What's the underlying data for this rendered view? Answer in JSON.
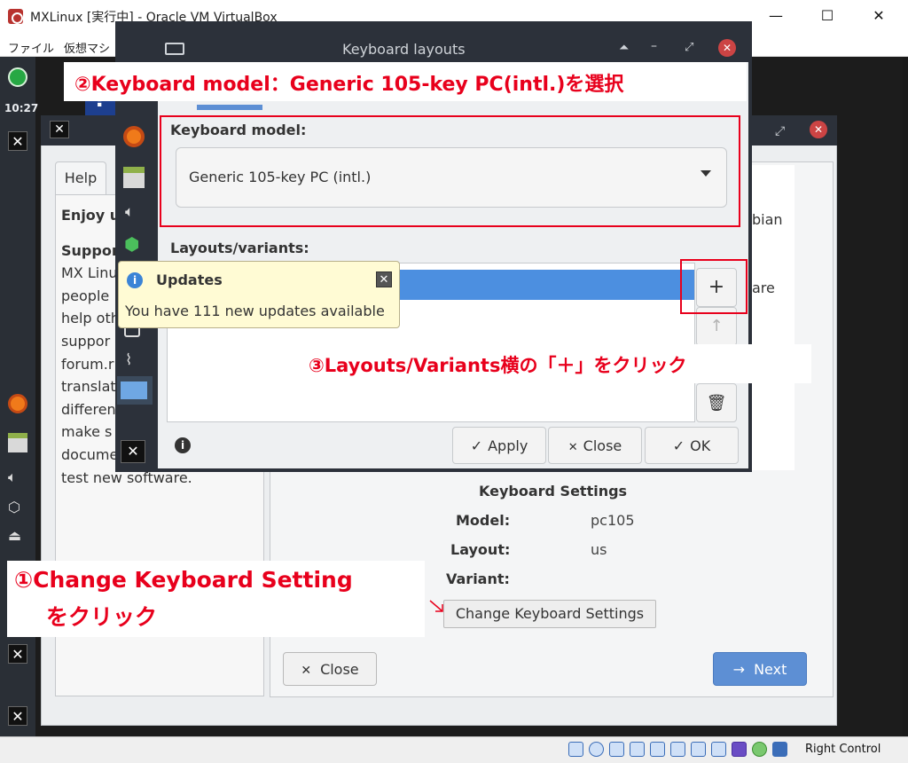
{
  "vbox": {
    "title": "MXLinux [実行中] - Oracle VM VirtualBox",
    "menus": [
      "ファイル",
      "仮想マシ"
    ],
    "status_text": "Right Control"
  },
  "panel": {
    "clock": "10:27"
  },
  "welcome": {
    "help_tab": "Help",
    "help_lines": [
      "Enjoy u",
      "Suppor",
      "MX Linu",
      "people",
      "help oth",
      "suppor",
      "forum.r",
      "translat",
      "differen",
      "make s",
      "docume",
      "test new software."
    ],
    "right_fragments": {
      "line1": "bian",
      "line2": "are"
    },
    "keyboard_settings": {
      "heading": "Keyboard Settings",
      "model_label": "Model:",
      "model_value": "pc105",
      "layout_label": "Layout:",
      "layout_value": "us",
      "variant_label": "Variant:",
      "variant_value": "",
      "change_button": "Change Keyboard Settings"
    },
    "close_button": "Close",
    "next_button": "Next"
  },
  "kbd_dialog": {
    "title": "Keyboard layouts",
    "model_label": "Keyboard model:",
    "model_value": "Generic 105-key PC (intl.)",
    "layouts_label": "Layouts/variants:",
    "apply_button": "Apply",
    "close_button": "Close",
    "ok_button": "OK"
  },
  "notification": {
    "title": "Updates",
    "body": "You have 111 new updates available"
  },
  "annotations": {
    "step1_line1": "①Change Keyboard Setting",
    "step1_line2": "をクリック",
    "step2": "②Keyboard model：Generic 105-key PC(intl.)を選択",
    "step3": "③Layouts/Variants横の「＋」をクリック"
  },
  "colors": {
    "annotation_red": "#e8001c",
    "selection_blue": "#4c8fe0",
    "next_blue": "#5d8fd4",
    "dark_chrome": "#2c313a"
  },
  "icons": [
    "firefox-icon",
    "file-manager-icon",
    "volume-icon",
    "package-icon",
    "eject-icon",
    "mx-logo-icon",
    "plus-icon",
    "arrow-up-icon",
    "trash-icon",
    "info-icon",
    "check-icon",
    "close-icon",
    "arrow-right-icon"
  ]
}
